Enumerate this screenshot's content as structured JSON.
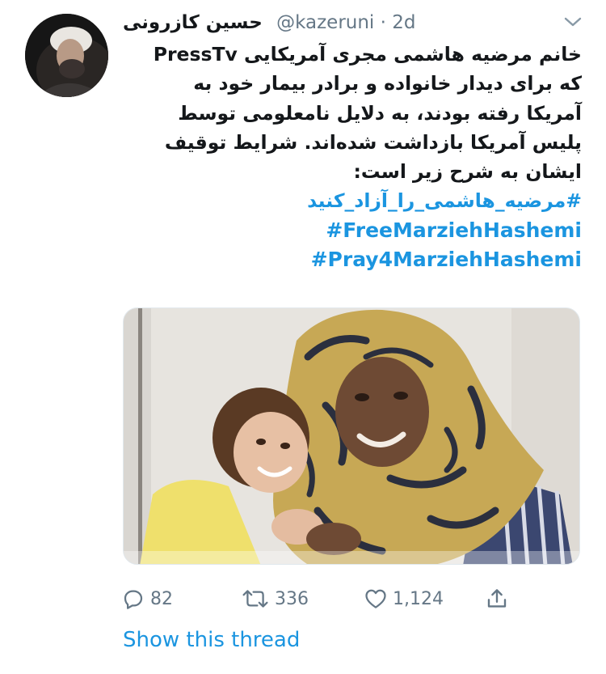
{
  "tweet": {
    "author": {
      "display_name": "حسین کازرونی",
      "handle": "@kazeruni",
      "separator": "·",
      "time": "2d"
    },
    "body_lines": [
      "خانم مرضیه هاشمی مجری آمریکایی PressTv",
      "که برای دیدار خانواده و برادر بیمار خود به",
      "آمریکا رفته بودند، به دلایل نامعلومی توسط",
      "پلیس آمریکا بازداشت شده‌اند. شرایط توقیف",
      "ایشان به شرح زیر است:"
    ],
    "hashtags": [
      "#مرضیه_هاشمی_را_آزاد_کنید",
      "#FreeMarziehHashemi",
      "#Pray4MarziehHashemi"
    ],
    "actions": {
      "replies": "82",
      "retweets": "336",
      "likes": "1,124"
    },
    "show_thread_label": "Show this thread"
  },
  "icons": {
    "caret": "chevron-down-icon",
    "reply": "reply-icon",
    "retweet": "retweet-icon",
    "like": "heart-icon",
    "share": "share-icon"
  },
  "colors": {
    "text": "#14171a",
    "secondary": "#657786",
    "link": "#1b95e0",
    "border": "#e1e8ed"
  }
}
